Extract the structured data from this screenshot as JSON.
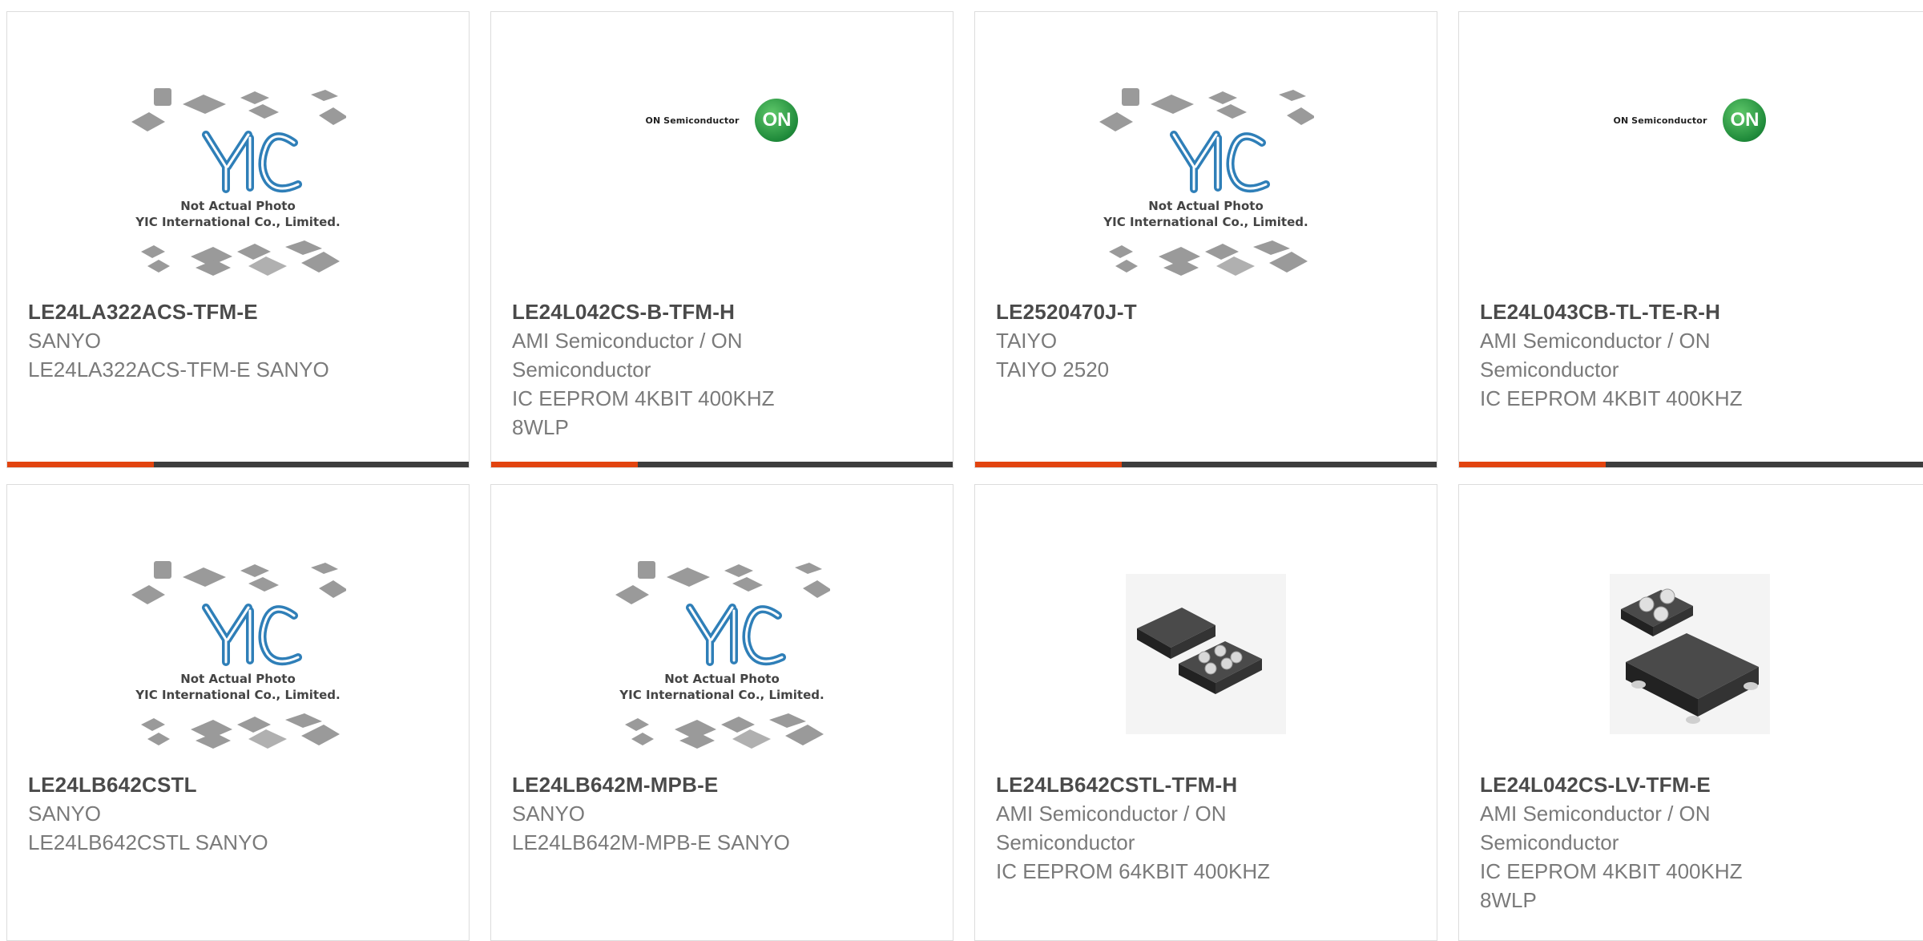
{
  "placeholder": {
    "line1": "Not Actual Photo",
    "line2": "YIC International Co., Limited.",
    "logo_letters": "YIC"
  },
  "on_logo": {
    "text": "ON Semiconductor",
    "mark": "ON",
    "brand_color": "#1f8a3a"
  },
  "accent_color": "#e2440f",
  "products": [
    {
      "part": "LE24LA322ACS-TFM-E",
      "maker": "SANYO",
      "desc": "LE24LA322ACS-TFM-E SANYO",
      "image": "yic-placeholder"
    },
    {
      "part": "LE24L042CS-B-TFM-H",
      "maker": "AMI Semiconductor / ON Semiconductor",
      "desc": "IC EEPROM 4KBIT 400KHZ 8WLP",
      "image": "on-semiconductor-logo"
    },
    {
      "part": "LE2520470J-T",
      "maker": "TAIYO",
      "desc": "TAIYO 2520",
      "image": "yic-placeholder"
    },
    {
      "part": "LE24L043CB-TL-TE-R-H",
      "maker": "AMI Semiconductor / ON Semiconductor",
      "desc": "IC EEPROM 4KBIT 400KHZ",
      "image": "on-semiconductor-logo"
    },
    {
      "part": "LE24LB642CSTL",
      "maker": "SANYO",
      "desc": "LE24LB642CSTL SANYO",
      "image": "yic-placeholder"
    },
    {
      "part": "LE24LB642M-MPB-E",
      "maker": "SANYO",
      "desc": "LE24LB642M-MPB-E SANYO",
      "image": "yic-placeholder"
    },
    {
      "part": "LE24LB642CSTL-TFM-H",
      "maker": "AMI Semiconductor / ON Semiconductor",
      "desc": "IC EEPROM 64KBIT 400KHZ",
      "image": "chip-photo-wlp-pair"
    },
    {
      "part": "LE24L042CS-LV-TFM-E",
      "maker": "AMI Semiconductor / ON Semiconductor",
      "desc": "IC EEPROM 4KBIT 400KHZ 8WLP",
      "image": "chip-photo-wlp-stack"
    }
  ]
}
